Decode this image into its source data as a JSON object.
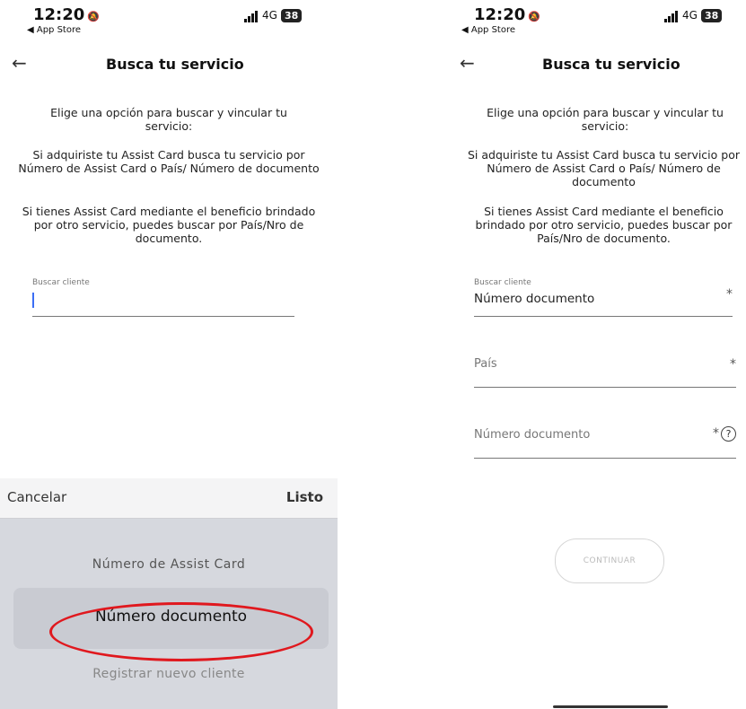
{
  "status_bar": {
    "time": "12:20",
    "back_app": "◀ App Store",
    "network": "4G",
    "battery": "38"
  },
  "header": {
    "back_icon": "←",
    "title": "Busca tu servicio"
  },
  "intro": {
    "p1": "Elige una opción para buscar y vincular tu servicio:",
    "p2": "Si adquiriste tu Assist Card busca tu servicio por Número de Assist Card o País/ Número de documento",
    "p3": "Si tienes Assist Card mediante el beneficio brindado por otro servicio, puedes buscar por País/Nro de documento."
  },
  "left_screen": {
    "search_label": "Buscar cliente"
  },
  "picker": {
    "cancel": "Cancelar",
    "done": "Listo",
    "options": [
      "Número de Assist Card",
      "Número documento",
      "Registrar nuevo cliente"
    ],
    "selected": "Número documento"
  },
  "right_screen": {
    "search_label": "Buscar cliente",
    "search_value": "Número documento",
    "country_placeholder": "País",
    "document_placeholder": "Número documento",
    "required_mark": "*",
    "help_icon": "?",
    "continue_button": "CONTINUAR"
  },
  "colors": {
    "highlight": "#e0181e",
    "cursor": "#3b6ef5",
    "picker_bg": "#d6d8de"
  }
}
